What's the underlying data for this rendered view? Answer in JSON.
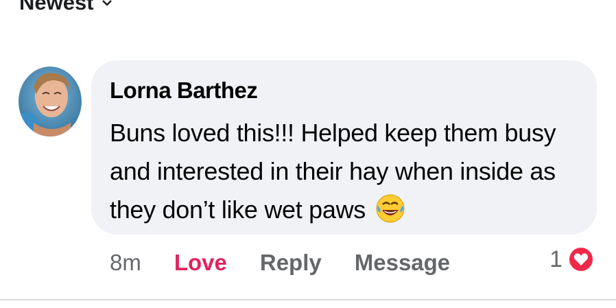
{
  "sort": {
    "label": "Newest",
    "icon": "chevron-down-icon"
  },
  "comment": {
    "author": "Lorna Barthez",
    "lines": [
      "Buns loved this!!! Helped keep them busy",
      "and interested in their hay when inside as",
      "they don’t like wet paws"
    ],
    "emoji": "face-with-tears-of-joy-icon",
    "time": "8m",
    "actions": {
      "love": "Love",
      "reply": "Reply",
      "message": "Message"
    },
    "reaction_count": "1",
    "reaction_icon": "heart-reaction-icon"
  },
  "colors": {
    "love": "#e0245e",
    "bubble": "#f0f2f5",
    "muted": "#65676b"
  }
}
